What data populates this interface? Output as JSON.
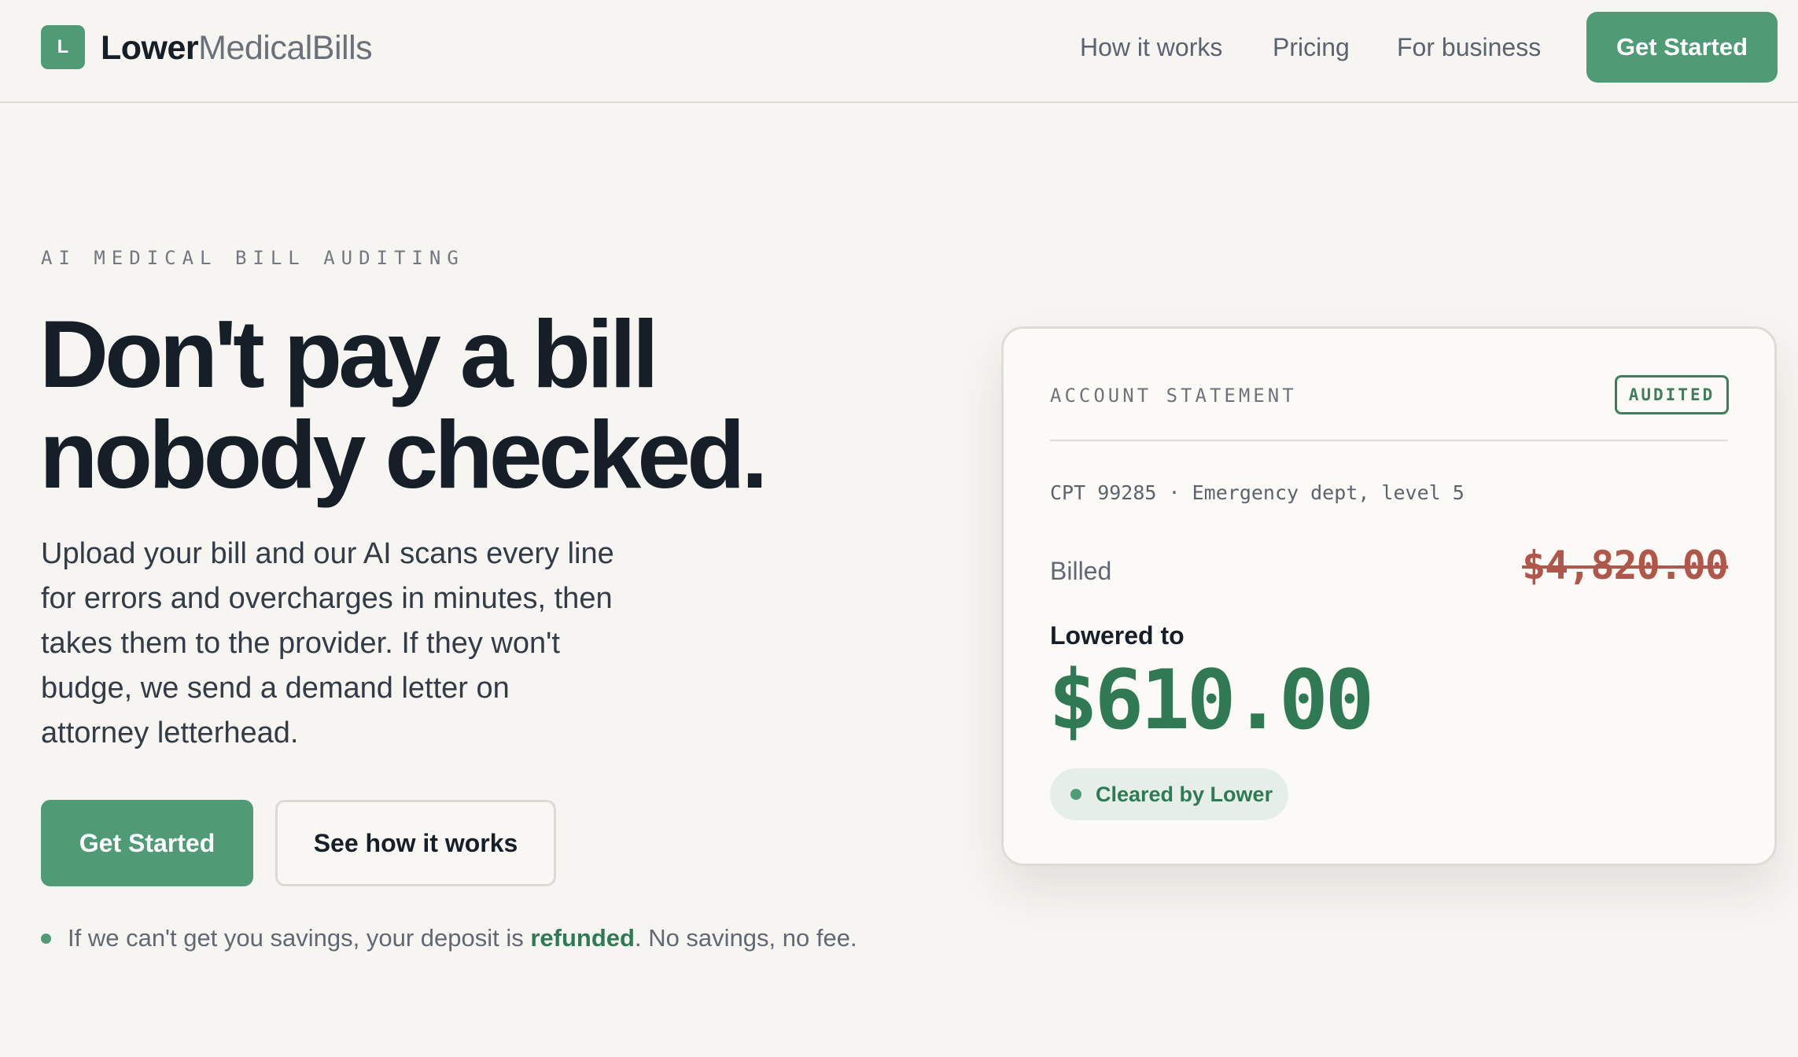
{
  "brand": {
    "logo_letter": "L",
    "name_bold": "Lower",
    "name_light": "MedicalBills",
    "accent_color": "#4e9b76"
  },
  "nav": {
    "items": [
      "How it works",
      "Pricing",
      "For business"
    ],
    "cta_label": "Get Started"
  },
  "hero": {
    "eyebrow": "AI MEDICAL BILL AUDITING",
    "headline_line1": "Don't pay a bill",
    "headline_line2": "nobody checked.",
    "lead": "Upload your bill and our AI scans every line for errors and overcharges in minutes, then takes them to the provider. If they won't budge, we send a demand letter on attorney letterhead.",
    "primary_cta": "Get Started",
    "secondary_cta": "See how it works",
    "guarantee_before": "If we can't get you savings, your deposit is ",
    "guarantee_highlight": "refunded",
    "guarantee_after": ". No savings, no fee."
  },
  "statement_card": {
    "title": "ACCOUNT STATEMENT",
    "badge": "AUDITED",
    "cpt_line": "CPT 99285 · Emergency dept, level 5",
    "billed_label": "Billed",
    "billed_amount": "$4,820.00",
    "lowered_label": "Lowered to",
    "lowered_amount": "$610.00",
    "status_pill": "Cleared by Lower",
    "billed_color": "#b2564a",
    "lowered_color": "#2f7a55"
  }
}
